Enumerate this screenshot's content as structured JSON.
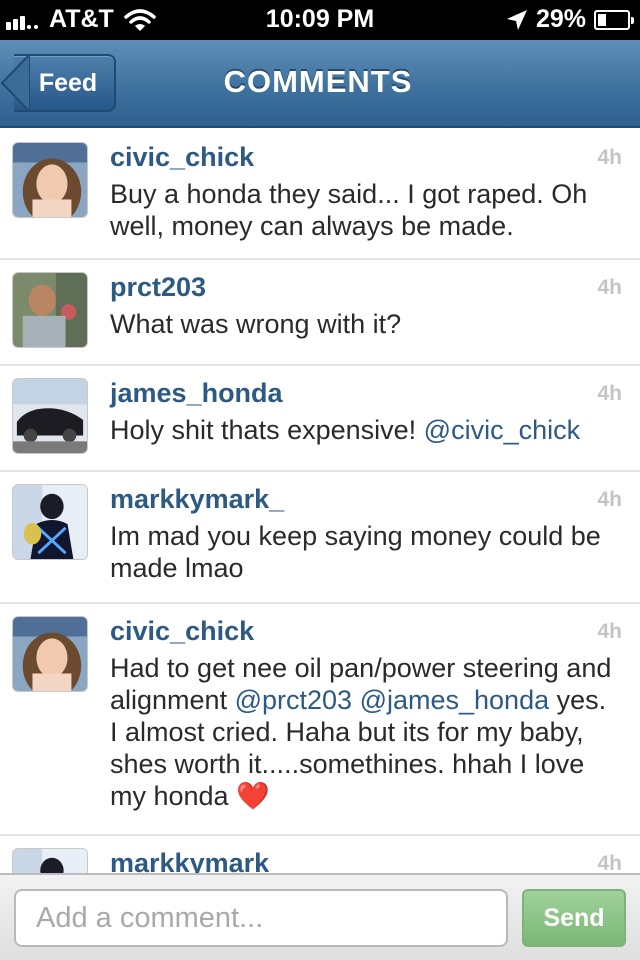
{
  "status_bar": {
    "carrier": "AT&T",
    "time": "10:09 PM",
    "battery_percent": "29%",
    "battery_level": 0.29,
    "icons": [
      "signal-icon",
      "wifi-icon",
      "location-arrow-icon",
      "battery-icon"
    ]
  },
  "nav": {
    "back_label": "Feed",
    "title": "COMMENTS",
    "color": "#3f729e"
  },
  "comments": [
    {
      "username": "civic_chick",
      "time": "4h",
      "text": "Buy a honda they said... I got raped. Oh well, money can always be made."
    },
    {
      "username": "prct203",
      "time": "4h",
      "text": "What was wrong with it?"
    },
    {
      "username": "james_honda",
      "time": "4h",
      "text": "Holy shit thats expensive!",
      "mention": "@civic_chick"
    },
    {
      "username": "markkymark_",
      "time": "4h",
      "text": "Im mad you keep saying money could be made lmao"
    },
    {
      "username": "civic_chick",
      "time": "4h",
      "text_part1": "Had to get nee oil pan/power steering and alignment",
      "mention1": "@prct203",
      "mention2": "@james_honda",
      "text_part2": "yes. I almost cried. Haha but its for my baby, shes worth it.....somethines. hhah I love my honda",
      "emoji": "❤️"
    },
    {
      "username": "markkymark",
      "time": "4h"
    }
  ],
  "input": {
    "placeholder": "Add a comment...",
    "send_label": "Send",
    "send_color": "#7bb776"
  }
}
